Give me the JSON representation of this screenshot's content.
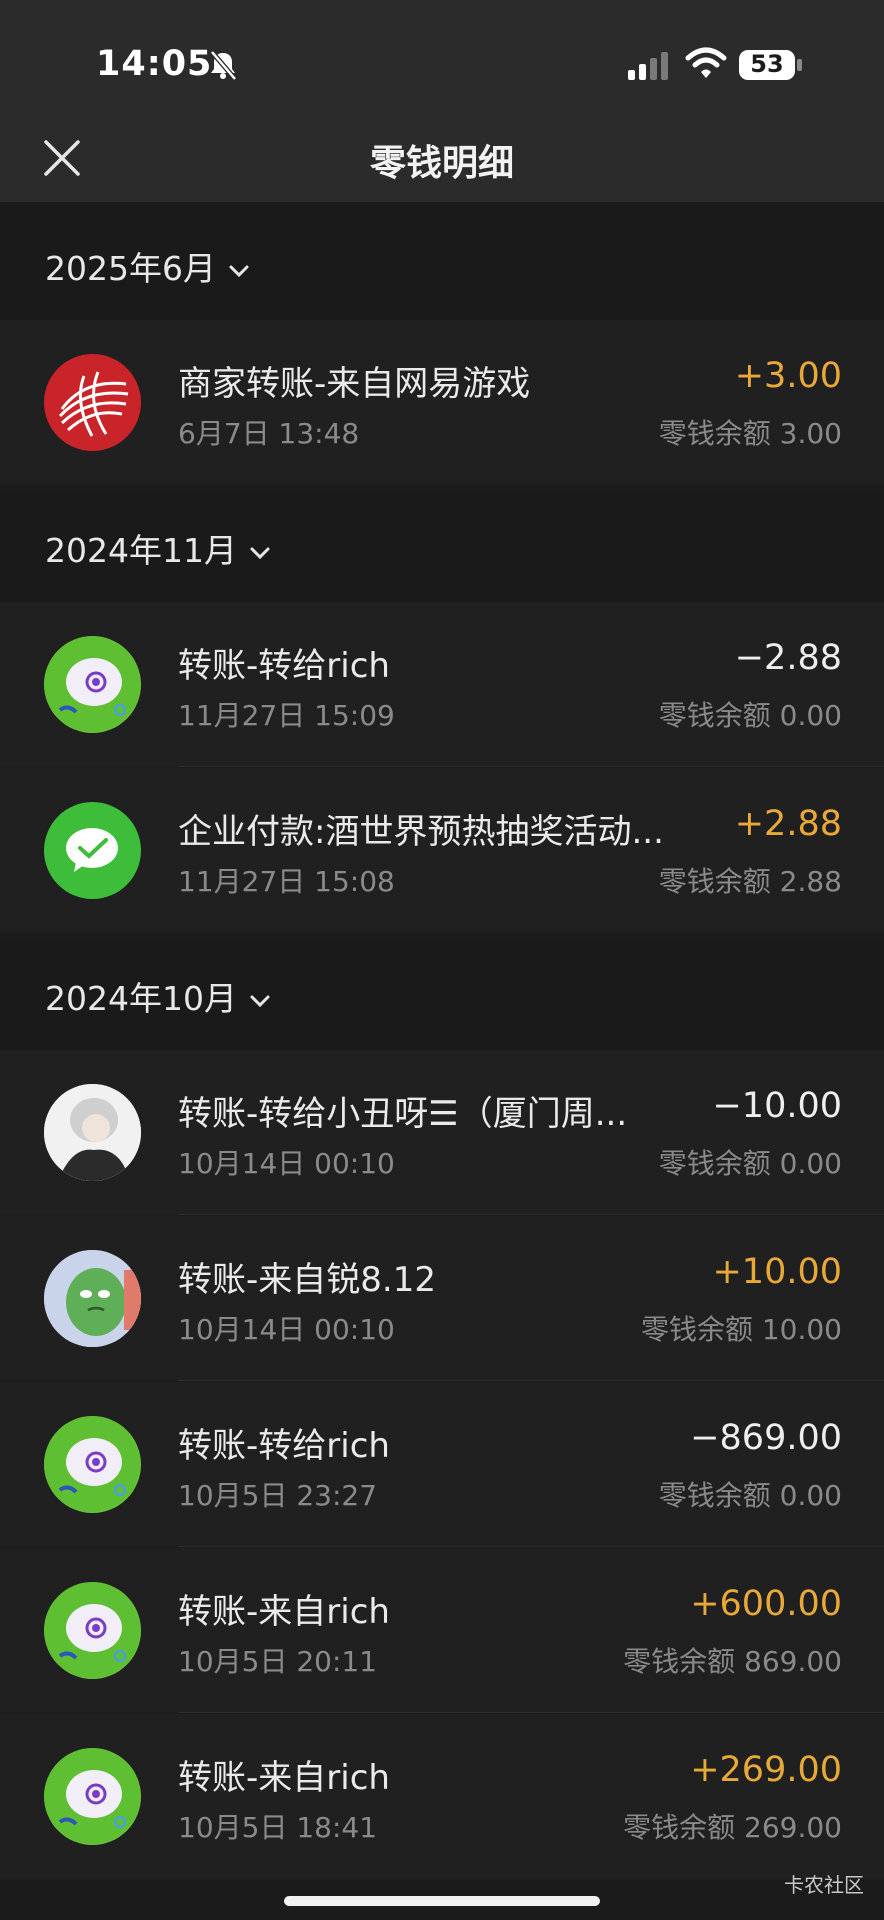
{
  "status_bar": {
    "time": "14:05",
    "battery": "53"
  },
  "header": {
    "title": "零钱明细"
  },
  "sections": [
    {
      "month": "2025年6月",
      "items": [
        {
          "title": "商家转账-来自网易游戏",
          "time": "6月7日 13:48",
          "amount": "+3.00",
          "balance": "零钱余额 3.00"
        }
      ]
    },
    {
      "month": "2024年11月",
      "items": [
        {
          "title": "转账-转给rich",
          "time": "11月27日 15:09",
          "amount": "−2.88",
          "balance": "零钱余额 0.00"
        },
        {
          "title": "企业付款:酒世界预热抽奖活动...",
          "time": "11月27日 15:08",
          "amount": "+2.88",
          "balance": "零钱余额 2.88"
        }
      ]
    },
    {
      "month": "2024年10月",
      "items": [
        {
          "title": "转账-转给小丑呀☰（厦门周...",
          "time": "10月14日 00:10",
          "amount": "−10.00",
          "balance": "零钱余额 0.00"
        },
        {
          "title": "转账-来自锐8.12",
          "time": "10月14日 00:10",
          "amount": "+10.00",
          "balance": "零钱余额 10.00"
        },
        {
          "title": "转账-转给rich",
          "time": "10月5日 23:27",
          "amount": "−869.00",
          "balance": "零钱余额 0.00"
        },
        {
          "title": "转账-来自rich",
          "time": "10月5日 20:11",
          "amount": "+600.00",
          "balance": "零钱余额 869.00"
        },
        {
          "title": "转账-来自rich",
          "time": "10月5日 18:41",
          "amount": "+269.00",
          "balance": "零钱余额 269.00"
        }
      ]
    }
  ],
  "watermark": "卡农社区",
  "colors": {
    "income": "#e9a937",
    "background": "#1b1b1b",
    "row": "#202020"
  }
}
